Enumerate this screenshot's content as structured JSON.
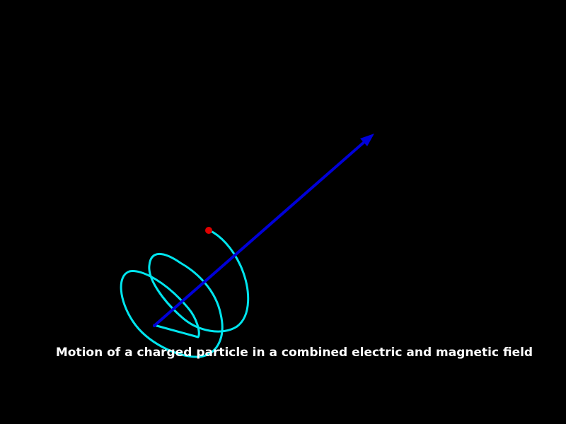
{
  "caption": "Motion of a charged particle in a combined electric and magnetic field",
  "colors": {
    "background": "#000000",
    "trajectory": "#00e5ee",
    "field_vector": "#0000d8",
    "particle": "#e00000",
    "caption": "#ffffff"
  },
  "elements": {
    "trajectory": "helical-path",
    "field_vector": "arrow",
    "particle": "filled-dot"
  }
}
